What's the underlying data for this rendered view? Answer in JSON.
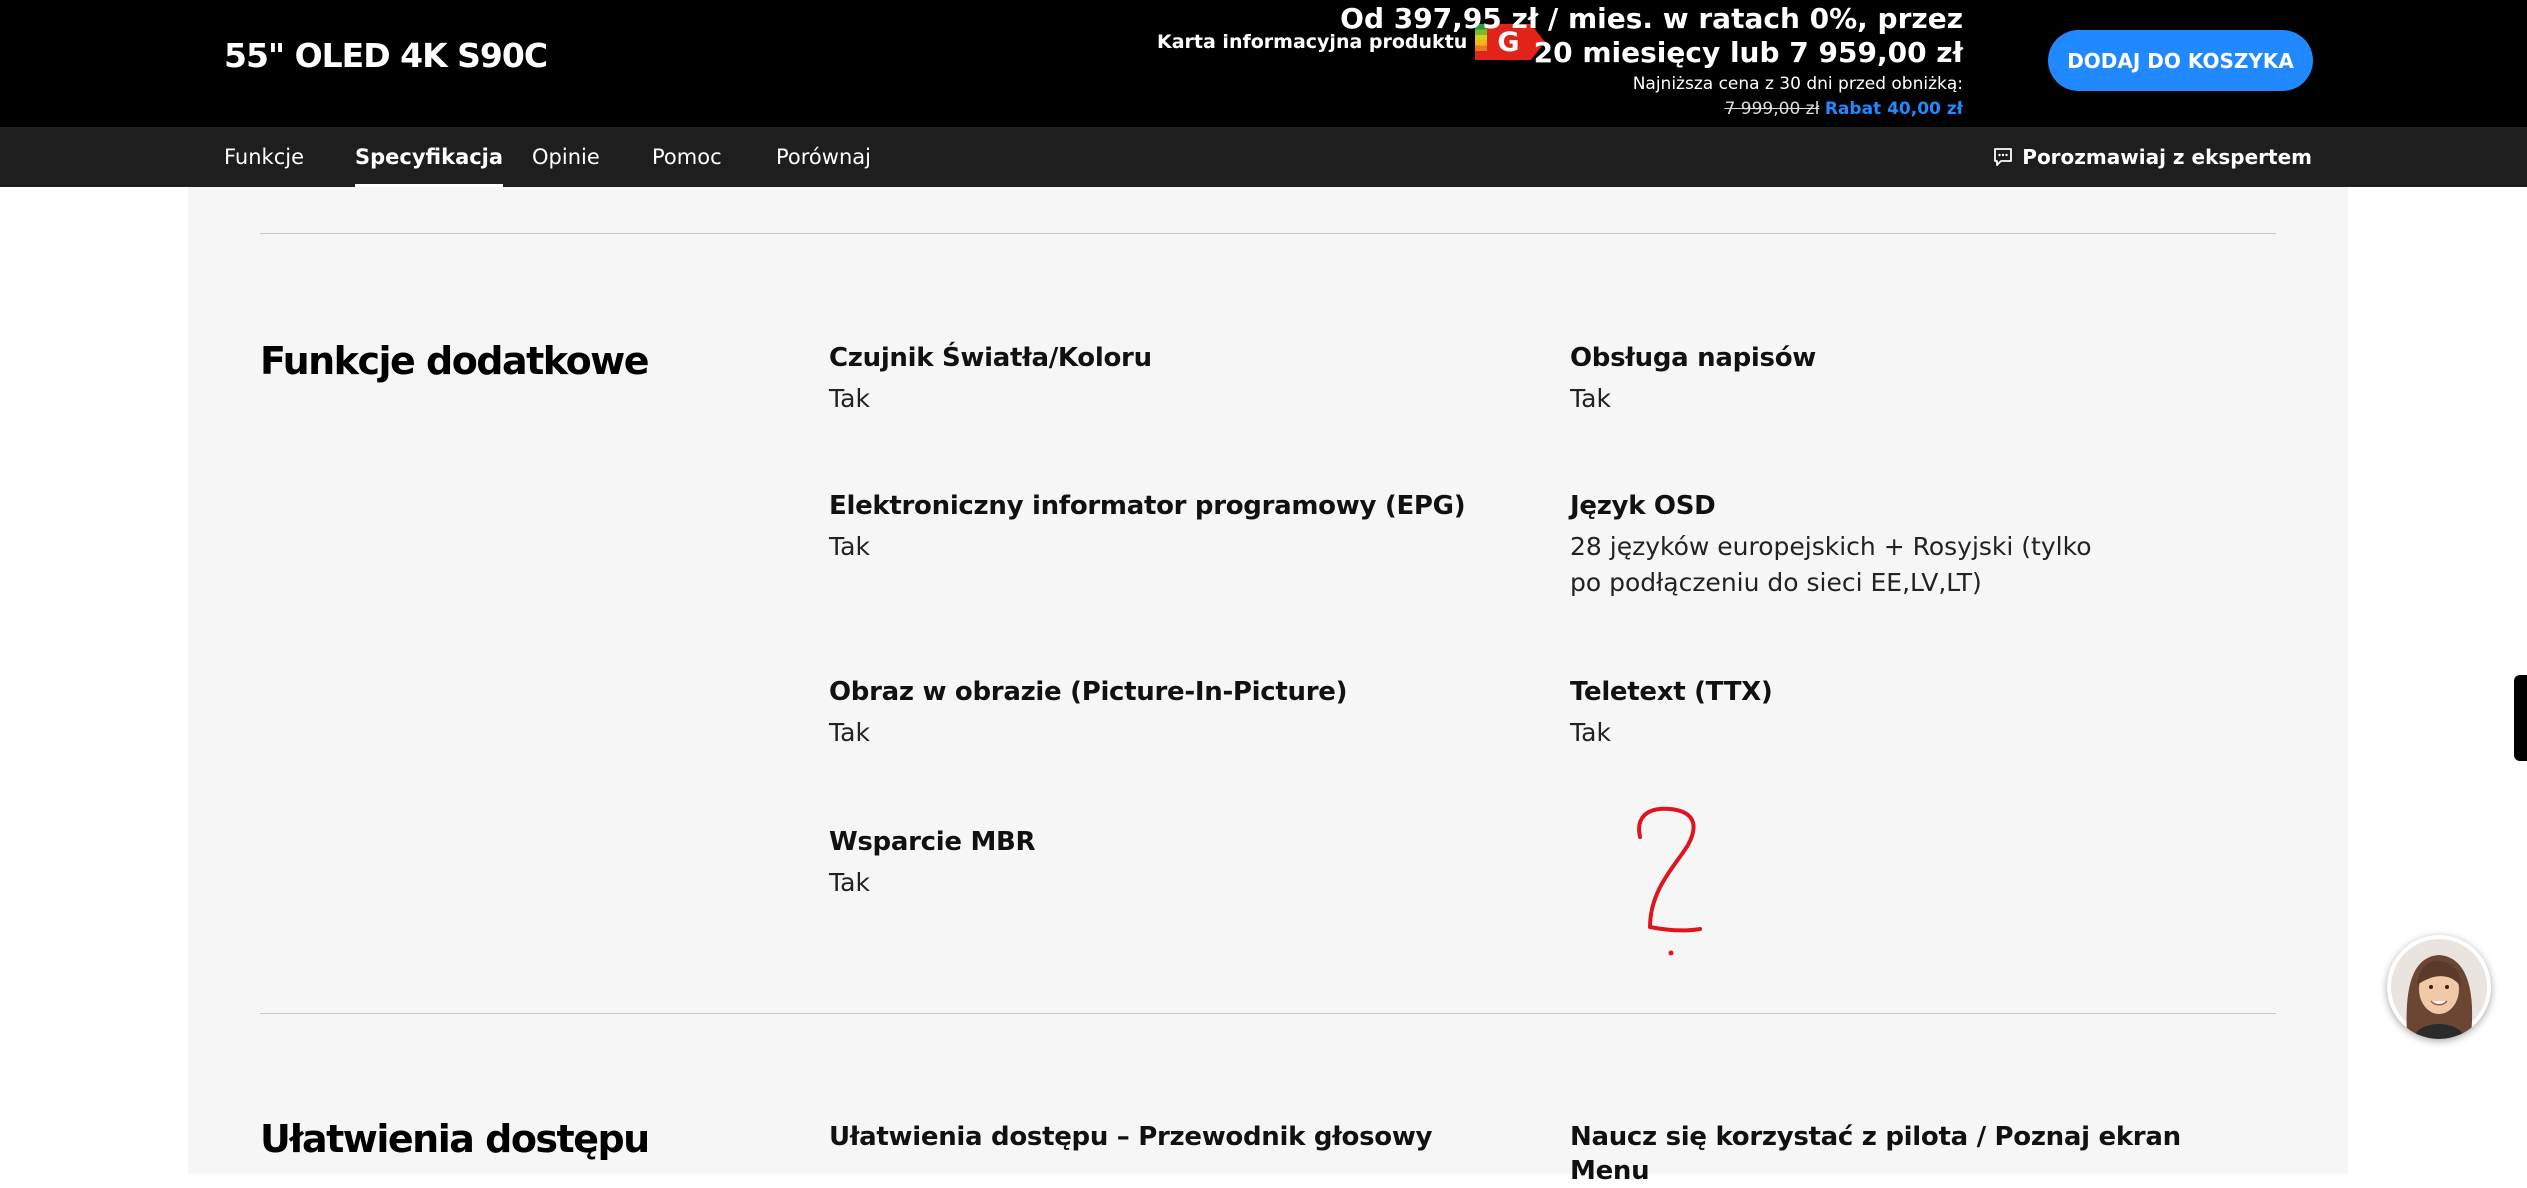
{
  "header": {
    "product_title": "55\" OLED 4K S90C",
    "label_card": "Karta informacyjna produktu",
    "energy_class": "G",
    "price_line1": "Od 397,95 zł / mies. w ratach 0%, przez",
    "price_line2": "20 miesięcy lub 7 959,00 zł",
    "lowest_price_note": "Najniższa cena z 30 dni przed obniżką:",
    "old_price": "7 999,00 zł",
    "discount": "Rabat 40,00 zł",
    "cart_button": "DODAJ DO KOSZYKA"
  },
  "nav": {
    "tabs": [
      {
        "label": "Funkcje"
      },
      {
        "label": "Specyfikacja"
      },
      {
        "label": "Opinie"
      },
      {
        "label": "Pomoc"
      },
      {
        "label": "Porównaj"
      }
    ],
    "active_tab": "Specyfikacja",
    "chat_label": "Porozmawiaj z ekspertem"
  },
  "sections": [
    {
      "title": "Funkcje dodatkowe",
      "specs": [
        {
          "name": "Czujnik Światła/Koloru",
          "value": "Tak"
        },
        {
          "name": "Obsługa napisów",
          "value": "Tak"
        },
        {
          "name": "Elektroniczny informator programowy (EPG)",
          "value": "Tak"
        },
        {
          "name": "Język OSD",
          "value": "28 języków europejskich + Rosyjski (tylko po podłączeniu do sieci EE,LV,LT)"
        },
        {
          "name": "Obraz w obrazie (Picture-In-Picture)",
          "value": "Tak"
        },
        {
          "name": "Teletext (TTX)",
          "value": "Tak"
        },
        {
          "name": "Wsparcie MBR",
          "value": "Tak"
        }
      ]
    },
    {
      "title": "Ułatwienia dostępu",
      "specs": [
        {
          "name": "Ułatwienia dostępu – Przewodnik głosowy",
          "value": ""
        },
        {
          "name": "Naucz się korzystać z pilota / Poznaj ekran Menu",
          "value": ""
        }
      ]
    }
  ],
  "annotation": {
    "color": "#e0141e"
  },
  "colors": {
    "accent": "#2189ff",
    "header_bg": "#000000",
    "nav_bg": "#1e1e1e",
    "panel_bg": "#f6f6f6",
    "energy": "#e2231a"
  }
}
